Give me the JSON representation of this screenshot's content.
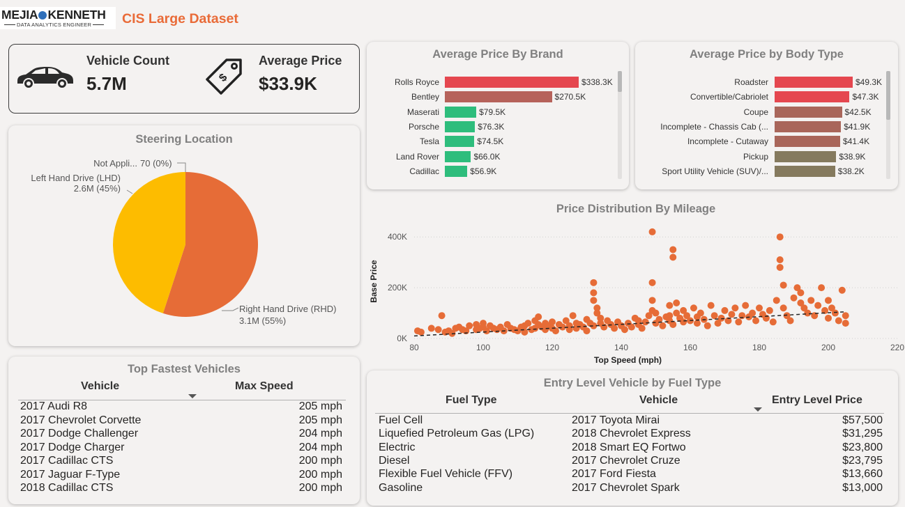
{
  "header": {
    "logo_main_left": "MEJIA",
    "logo_main_right": "KENNETH",
    "logo_sub": "DATA ANALYTICS ENGINEER",
    "title": "CIS Large Dataset"
  },
  "kpis": {
    "vehicle_count_label": "Vehicle Count",
    "vehicle_count_value": "5.7M",
    "avg_price_label": "Average Price",
    "avg_price_value": "$33.9K",
    "car_icon": "car-icon",
    "tag_icon": "price-tag-icon"
  },
  "brand_chart": {
    "title": "Average Price By Brand",
    "rows": [
      {
        "label": "Rolls Royce",
        "value": 338.3,
        "text": "$338.3K",
        "color": "#e5474f"
      },
      {
        "label": "Bentley",
        "value": 270.5,
        "text": "$270.5K",
        "color": "#b6625a"
      },
      {
        "label": "Maserati",
        "value": 79.5,
        "text": "$79.5K",
        "color": "#2ebd7c"
      },
      {
        "label": "Porsche",
        "value": 76.3,
        "text": "$76.3K",
        "color": "#2ebd7c"
      },
      {
        "label": "Tesla",
        "value": 74.5,
        "text": "$74.5K",
        "color": "#2ebd7c"
      },
      {
        "label": "Land Rover",
        "value": 66.0,
        "text": "$66.0K",
        "color": "#2ebd7c"
      },
      {
        "label": "Cadillac",
        "value": 56.9,
        "text": "$56.9K",
        "color": "#2ebd7c"
      }
    ]
  },
  "body_chart": {
    "title": "Average Price by Body Type",
    "rows": [
      {
        "label": "Roadster",
        "value": 49.3,
        "text": "$49.3K",
        "color": "#e5474f"
      },
      {
        "label": "Convertible/Cabriolet",
        "value": 47.3,
        "text": "$47.3K",
        "color": "#e5474f"
      },
      {
        "label": "Coupe",
        "value": 42.5,
        "text": "$42.5K",
        "color": "#a9665a"
      },
      {
        "label": "Incomplete - Chassis Cab (...",
        "value": 41.9,
        "text": "$41.9K",
        "color": "#a9665a"
      },
      {
        "label": "Incomplete - Cutaway",
        "value": 41.4,
        "text": "$41.4K",
        "color": "#a9665a"
      },
      {
        "label": "Pickup",
        "value": 38.9,
        "text": "$38.9K",
        "color": "#857a5e"
      },
      {
        "label": "Sport Utility Vehicle (SUV)/...",
        "value": 38.2,
        "text": "$38.2K",
        "color": "#857a5e"
      }
    ]
  },
  "steering": {
    "title": "Steering Location",
    "slices": [
      {
        "label": "Right Hand Drive (RHD)",
        "value_text": "3.1M (55%)",
        "share": 0.55,
        "color": "#e66c37"
      },
      {
        "label": "Left Hand Drive (LHD)",
        "value_text": "2.6M (45%)",
        "share": 0.45,
        "color": "#fdbc00"
      },
      {
        "label": "Not Appli...",
        "value_text": "70 (0%)",
        "share": 0.0,
        "color": "#888888"
      }
    ]
  },
  "chart_data": {
    "type": "scatter",
    "title": "Price Distribution By Mileage",
    "xlabel": "Top Speed (mph)",
    "ylabel": "Base Price",
    "xlim": [
      80,
      220
    ],
    "ylim": [
      0,
      450000
    ],
    "xticks": [
      "80",
      "100",
      "120",
      "140",
      "160",
      "180",
      "200",
      "220"
    ],
    "yticks": [
      "0K",
      "200K",
      "400K"
    ],
    "ytick_values": [
      0,
      200000,
      400000
    ],
    "xtick_values": [
      80,
      100,
      120,
      140,
      160,
      180,
      200,
      220
    ],
    "point_color": "#e66c37",
    "trend": [
      [
        80,
        10000
      ],
      [
        205,
        105000
      ]
    ],
    "points": [
      [
        81,
        30000
      ],
      [
        82,
        25000
      ],
      [
        85,
        40000
      ],
      [
        87,
        35000
      ],
      [
        88,
        90000
      ],
      [
        89,
        25000
      ],
      [
        90,
        30000
      ],
      [
        91,
        20000
      ],
      [
        92,
        40000
      ],
      [
        93,
        45000
      ],
      [
        94,
        35000
      ],
      [
        95,
        30000
      ],
      [
        96,
        50000
      ],
      [
        98,
        55000
      ],
      [
        98,
        35000
      ],
      [
        99,
        40000
      ],
      [
        100,
        45000
      ],
      [
        100,
        60000
      ],
      [
        101,
        30000
      ],
      [
        102,
        50000
      ],
      [
        103,
        40000
      ],
      [
        104,
        35000
      ],
      [
        105,
        45000
      ],
      [
        106,
        30000
      ],
      [
        107,
        55000
      ],
      [
        108,
        40000
      ],
      [
        109,
        35000
      ],
      [
        110,
        30000
      ],
      [
        111,
        45000
      ],
      [
        112,
        50000
      ],
      [
        112,
        25000
      ],
      [
        113,
        60000
      ],
      [
        114,
        35000
      ],
      [
        115,
        40000
      ],
      [
        115,
        70000
      ],
      [
        116,
        55000
      ],
      [
        116,
        85000
      ],
      [
        117,
        45000
      ],
      [
        118,
        60000
      ],
      [
        118,
        35000
      ],
      [
        119,
        50000
      ],
      [
        120,
        40000
      ],
      [
        120,
        65000
      ],
      [
        121,
        30000
      ],
      [
        122,
        55000
      ],
      [
        123,
        45000
      ],
      [
        124,
        70000
      ],
      [
        125,
        50000
      ],
      [
        125,
        35000
      ],
      [
        126,
        90000
      ],
      [
        127,
        60000
      ],
      [
        127,
        40000
      ],
      [
        128,
        55000
      ],
      [
        129,
        45000
      ],
      [
        130,
        30000
      ],
      [
        130,
        75000
      ],
      [
        131,
        60000
      ],
      [
        132,
        50000
      ],
      [
        132,
        180000
      ],
      [
        132,
        220000
      ],
      [
        132,
        150000
      ],
      [
        133,
        120000
      ],
      [
        133,
        100000
      ],
      [
        134,
        80000
      ],
      [
        134,
        60000
      ],
      [
        135,
        45000
      ],
      [
        136,
        70000
      ],
      [
        137,
        55000
      ],
      [
        138,
        40000
      ],
      [
        139,
        65000
      ],
      [
        140,
        50000
      ],
      [
        141,
        35000
      ],
      [
        142,
        60000
      ],
      [
        143,
        45000
      ],
      [
        144,
        80000
      ],
      [
        145,
        55000
      ],
      [
        145,
        70000
      ],
      [
        146,
        40000
      ],
      [
        147,
        65000
      ],
      [
        148,
        90000
      ],
      [
        149,
        420000
      ],
      [
        149,
        220000
      ],
      [
        149,
        150000
      ],
      [
        149,
        110000
      ],
      [
        150,
        60000
      ],
      [
        150,
        100000
      ],
      [
        151,
        75000
      ],
      [
        152,
        50000
      ],
      [
        153,
        85000
      ],
      [
        154,
        130000
      ],
      [
        154,
        90000
      ],
      [
        154,
        70000
      ],
      [
        155,
        350000
      ],
      [
        155,
        320000
      ],
      [
        155,
        55000
      ],
      [
        156,
        100000
      ],
      [
        156,
        140000
      ],
      [
        157,
        80000
      ],
      [
        158,
        65000
      ],
      [
        158,
        110000
      ],
      [
        159,
        90000
      ],
      [
        160,
        70000
      ],
      [
        161,
        120000
      ],
      [
        162,
        85000
      ],
      [
        162,
        60000
      ],
      [
        163,
        100000
      ],
      [
        164,
        75000
      ],
      [
        165,
        50000
      ],
      [
        166,
        130000
      ],
      [
        167,
        90000
      ],
      [
        168,
        60000
      ],
      [
        169,
        80000
      ],
      [
        170,
        110000
      ],
      [
        171,
        70000
      ],
      [
        172,
        95000
      ],
      [
        173,
        120000
      ],
      [
        174,
        65000
      ],
      [
        175,
        90000
      ],
      [
        176,
        130000
      ],
      [
        177,
        85000
      ],
      [
        178,
        100000
      ],
      [
        179,
        70000
      ],
      [
        180,
        120000
      ],
      [
        181,
        95000
      ],
      [
        182,
        80000
      ],
      [
        183,
        110000
      ],
      [
        184,
        65000
      ],
      [
        185,
        150000
      ],
      [
        186,
        400000
      ],
      [
        186,
        310000
      ],
      [
        186,
        280000
      ],
      [
        187,
        120000
      ],
      [
        187,
        210000
      ],
      [
        188,
        90000
      ],
      [
        189,
        70000
      ],
      [
        190,
        160000
      ],
      [
        191,
        200000
      ],
      [
        192,
        140000
      ],
      [
        192,
        180000
      ],
      [
        193,
        120000
      ],
      [
        194,
        100000
      ],
      [
        195,
        150000
      ],
      [
        196,
        90000
      ],
      [
        197,
        130000
      ],
      [
        198,
        200000
      ],
      [
        199,
        110000
      ],
      [
        200,
        150000
      ],
      [
        200,
        80000
      ],
      [
        201,
        120000
      ],
      [
        202,
        100000
      ],
      [
        203,
        70000
      ],
      [
        204,
        190000
      ],
      [
        205,
        90000
      ],
      [
        205,
        60000
      ]
    ]
  },
  "fastest": {
    "title": "Top Fastest Vehicles",
    "col_vehicle": "Vehicle",
    "col_speed": "Max Speed",
    "rows": [
      {
        "vehicle": "2017 Audi R8",
        "speed": "205 mph"
      },
      {
        "vehicle": "2017 Chevrolet Corvette",
        "speed": "205 mph"
      },
      {
        "vehicle": "2017 Dodge Challenger",
        "speed": "204 mph"
      },
      {
        "vehicle": "2017 Dodge Charger",
        "speed": "204 mph"
      },
      {
        "vehicle": "2017 Cadillac CTS",
        "speed": "200 mph"
      },
      {
        "vehicle": "2017 Jaguar F-Type",
        "speed": "200 mph"
      },
      {
        "vehicle": "2018 Cadillac CTS",
        "speed": "200 mph"
      }
    ]
  },
  "entry": {
    "title": "Entry Level Vehicle by Fuel Type",
    "col_fuel": "Fuel Type",
    "col_vehicle": "Vehicle",
    "col_price": "Entry Level Price",
    "rows": [
      {
        "fuel": "Fuel Cell",
        "vehicle": "2017 Toyota Mirai",
        "price": "$57,500"
      },
      {
        "fuel": "Liquefied Petroleum Gas (LPG)",
        "vehicle": "2018 Chevrolet Express",
        "price": "$31,295"
      },
      {
        "fuel": "Electric",
        "vehicle": "2018 Smart EQ Fortwo",
        "price": "$23,800"
      },
      {
        "fuel": "Diesel",
        "vehicle": "2017 Chevrolet Cruze",
        "price": "$23,795"
      },
      {
        "fuel": "Flexible Fuel Vehicle (FFV)",
        "vehicle": "2017 Ford Fiesta",
        "price": "$13,660"
      },
      {
        "fuel": "Gasoline",
        "vehicle": "2017 Chevrolet Spark",
        "price": "$13,000"
      }
    ]
  }
}
